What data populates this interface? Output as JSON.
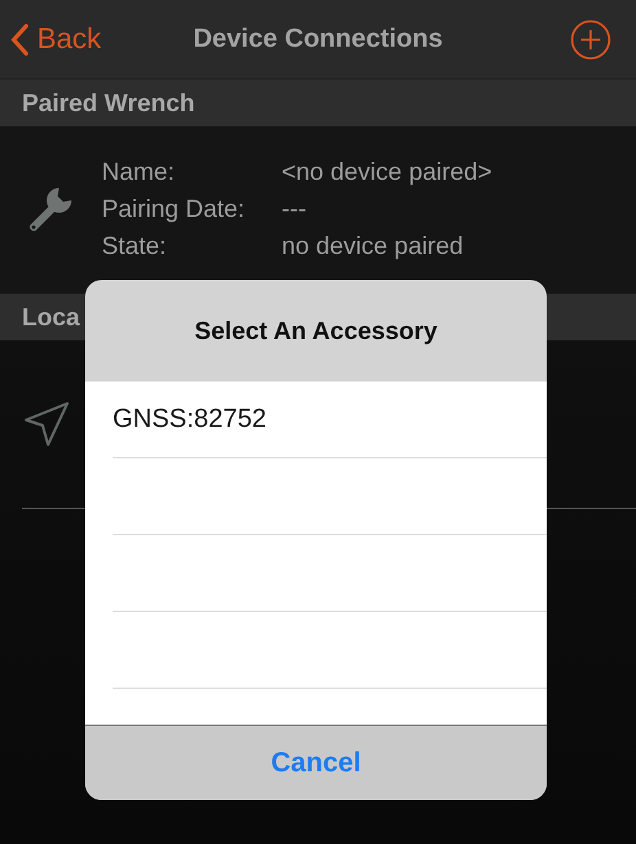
{
  "nav": {
    "back": "Back",
    "title": "Device Connections"
  },
  "sections": [
    {
      "kind": "wrench",
      "header": "Paired Wrench",
      "fields": [
        {
          "label": "Name:",
          "value": "<no device paired>"
        },
        {
          "label": "Pairing Date:",
          "value": "---"
        },
        {
          "label": "State:",
          "value": "no device paired"
        }
      ]
    },
    {
      "kind": "location",
      "header": "Loca"
    }
  ],
  "dialog": {
    "title": "Select An Accessory",
    "items": [
      "GNSS:82752"
    ],
    "cancel": "Cancel"
  }
}
